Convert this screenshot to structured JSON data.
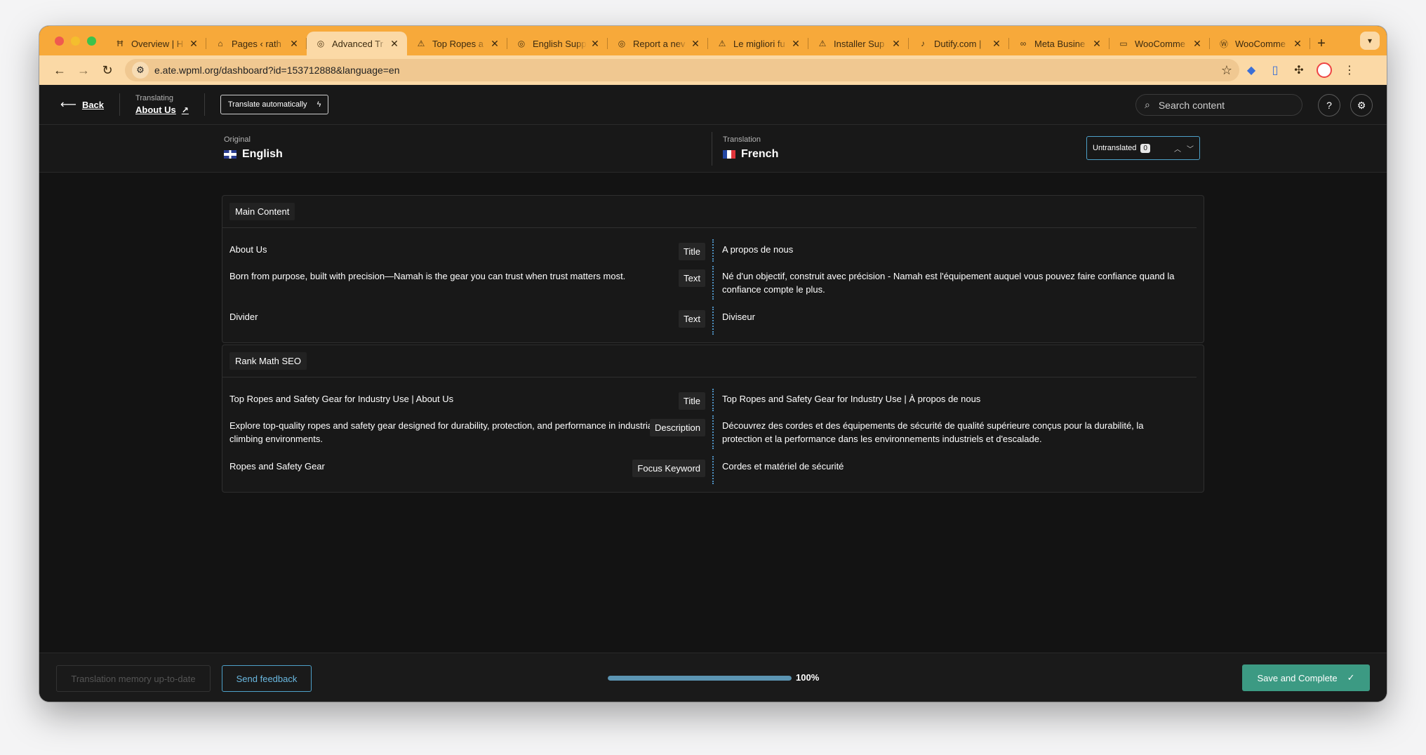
{
  "browser": {
    "tabs": [
      {
        "title": "Overview | H",
        "icon": "Ħ",
        "active": false
      },
      {
        "title": "Pages ‹ rath",
        "icon": "⌂",
        "active": false
      },
      {
        "title": "Advanced Tr",
        "icon": "◎",
        "active": true
      },
      {
        "title": "Top Ropes a",
        "icon": "⚠",
        "active": false
      },
      {
        "title": "English Supp",
        "icon": "◎",
        "active": false
      },
      {
        "title": "Report a nev",
        "icon": "◎",
        "active": false
      },
      {
        "title": "Le migliori fu",
        "icon": "⚠",
        "active": false
      },
      {
        "title": "Installer Sup",
        "icon": "⚠",
        "active": false
      },
      {
        "title": "Dutify.com |",
        "icon": "♪",
        "active": false
      },
      {
        "title": "Meta Busine",
        "icon": "∞",
        "active": false
      },
      {
        "title": "WooComme",
        "icon": "▭",
        "active": false
      },
      {
        "title": "WooComme",
        "icon": "Ⓦ",
        "active": false
      }
    ],
    "url": "e.ate.wpml.org/dashboard?id=153712888&language=en"
  },
  "header": {
    "back_label": "Back",
    "translating_label": "Translating",
    "page_name": "About Us",
    "translate_auto_label": "Translate automatically",
    "search_placeholder": "Search content"
  },
  "languages": {
    "original_label": "Original",
    "original_lang": "English",
    "translation_label": "Translation",
    "translation_lang": "French",
    "untranslated_label": "Untranslated",
    "untranslated_count": "0"
  },
  "sections": [
    {
      "label": "Main Content",
      "rows": [
        {
          "src": "About Us",
          "tag": "Title",
          "tgt": "A propos de nous"
        },
        {
          "src": "Born from purpose, built with precision—Namah is the gear you can trust when trust matters most.",
          "tag": "Text",
          "tgt": "Né d'un objectif, construit avec précision - Namah est l'équipement auquel vous pouvez faire confiance quand la confiance compte le plus."
        },
        {
          "src": "Divider",
          "tag": "Text",
          "tgt": "Diviseur"
        }
      ]
    },
    {
      "label": "Rank Math SEO",
      "rows": [
        {
          "src": "Top Ropes and Safety Gear for Industry Use | About Us",
          "tag": "Title",
          "tgt": "Top Ropes and Safety Gear for Industry Use | À propos de nous"
        },
        {
          "src": "Explore top-quality ropes and safety gear designed for durability, protection, and performance in industrial and climbing environments.",
          "tag": "Description",
          "tgt": "Découvrez des cordes et des équipements de sécurité de qualité supérieure conçus pour la durabilité, la protection et la performance dans les environnements industriels et d'escalade."
        },
        {
          "src": "Ropes and Safety Gear",
          "tag": "Focus Keyword",
          "tgt": "Cordes et matériel de sécurité"
        }
      ]
    }
  ],
  "footer": {
    "tm_label": "Translation memory up-to-date",
    "feedback_label": "Send feedback",
    "progress_percent": 100,
    "progress_label": "100%",
    "save_label": "Save and Complete"
  }
}
